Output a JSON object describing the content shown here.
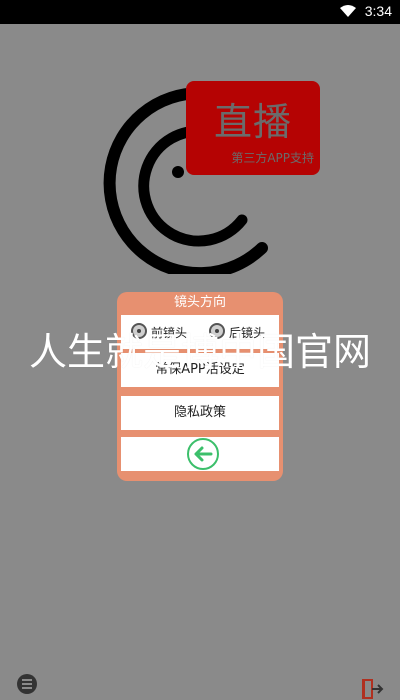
{
  "status_bar": {
    "time": "3:34"
  },
  "logo": {
    "badge_title": "直播",
    "badge_subtitle": "第三方APP支持",
    "badge_color": "#b50303"
  },
  "dialog": {
    "header": "镜头方向",
    "camera_options": [
      {
        "label": "前镜头"
      },
      {
        "label": "后镜头"
      }
    ],
    "keepalive_label": "常保APP活设定",
    "privacy_label": "隐私政策",
    "back_icon": "arrow-left-icon",
    "accent_color": "#e79070",
    "back_icon_color": "#3cbf6b"
  },
  "watermark": "人生就是博中国官网",
  "bottom_bar": {
    "left_icon": "menu-icon",
    "right_icon": "exit-icon"
  }
}
